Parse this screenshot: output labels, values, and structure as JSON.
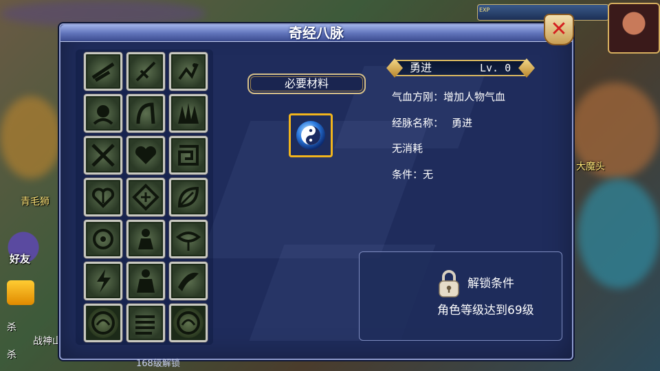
{
  "dialog": {
    "title": "奇经八脉",
    "close_icon": "close-x-icon"
  },
  "materials": {
    "label": "必要材料",
    "item_icon": "yin-yang-orb-icon"
  },
  "skill": {
    "name": "勇进",
    "level": "Lv. 0",
    "effect": "气血方刚：增加人物气血",
    "meridian_name_label": "经脉名称：",
    "meridian_name_value": "勇进",
    "cost": "无消耗",
    "condition": "条件：无"
  },
  "unlock": {
    "icon": "padlock-icon",
    "title": "解锁条件",
    "description": "角色等级达到69级"
  },
  "grid": {
    "slots": [
      {
        "icon": "sword-strike-icon"
      },
      {
        "icon": "dagger-icon"
      },
      {
        "icon": "music-notes-icon"
      },
      {
        "icon": "warrior-face-icon"
      },
      {
        "icon": "claw-arch-icon"
      },
      {
        "icon": "flame-spikes-icon"
      },
      {
        "icon": "crossed-weapons-icon"
      },
      {
        "icon": "heart-icon"
      },
      {
        "icon": "maze-rune-icon"
      },
      {
        "icon": "heart-sword-icon"
      },
      {
        "icon": "diamond-rune-icon"
      },
      {
        "icon": "leaf-icon"
      },
      {
        "icon": "swirl-eye-icon"
      },
      {
        "icon": "monk-figure-icon"
      },
      {
        "icon": "eye-rune-icon"
      },
      {
        "icon": "lightning-figure-icon"
      },
      {
        "icon": "general-figure-icon"
      },
      {
        "icon": "horn-icon"
      },
      {
        "icon": "dragon-medallion-icon"
      },
      {
        "icon": "stacked-blades-icon"
      },
      {
        "icon": "dragon-medallion-icon"
      }
    ]
  },
  "hud": {
    "exp_label": "EXP",
    "friend_label": "好友",
    "chat_lines": [
      "杀",
      "战神山脚",
      "杀"
    ],
    "bg_labels": [
      "青毛狮",
      "大魔头",
      "168级解锁"
    ]
  },
  "colors": {
    "dialog_bg": "#1f2c5c",
    "title_bar": "#5e71b8",
    "slot_border": "#c8c8c0",
    "item_border": "#f2b51c",
    "gold": "#d9b860",
    "close_x": "#d42020"
  }
}
